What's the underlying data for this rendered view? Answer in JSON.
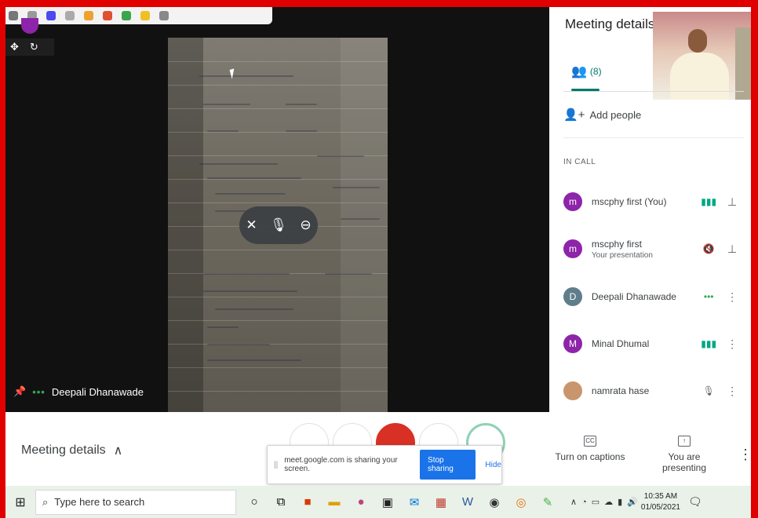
{
  "video": {
    "presenter_name": "Deepali Dhanawade",
    "hover_controls": [
      "pin",
      "mic",
      "remove"
    ]
  },
  "panel": {
    "title": "Meeting details",
    "people_count": "(8)",
    "add_people_label": "Add people",
    "section_label": "IN CALL",
    "participants": [
      {
        "initial": "m",
        "name": "mscphy first (You)",
        "sub": "",
        "color": "#8e24aa",
        "status": "speaking",
        "action": "pin"
      },
      {
        "initial": "m",
        "name": "mscphy first",
        "sub": "Your presentation",
        "color": "#8e24aa",
        "status": "muted",
        "action": "pin"
      },
      {
        "initial": "D",
        "name": "Deepali Dhanawade",
        "sub": "",
        "color": "#607d8b",
        "status": "dots",
        "action": "more"
      },
      {
        "initial": "M",
        "name": "Minal Dhumal",
        "sub": "",
        "color": "#8e24aa",
        "status": "speaking",
        "action": "more"
      },
      {
        "initial": "",
        "name": "namrata hase",
        "sub": "",
        "color": "#c8956d",
        "status": "mic-off",
        "action": "more"
      }
    ]
  },
  "bottom_bar": {
    "meeting_details_label": "Meeting details",
    "captions_label": "Turn on captions",
    "presenting_label": "You are presenting"
  },
  "share_notice": {
    "text": "meet.google.com is sharing your screen.",
    "stop_label": "Stop sharing",
    "hide_label": "Hide"
  },
  "taskbar": {
    "search_placeholder": "Type here to search",
    "time": "10:35 AM",
    "date": "01/05/2021"
  },
  "colors": {
    "accent": "#00796b",
    "blue": "#1a73e8",
    "speaking_green": "#34a853"
  }
}
